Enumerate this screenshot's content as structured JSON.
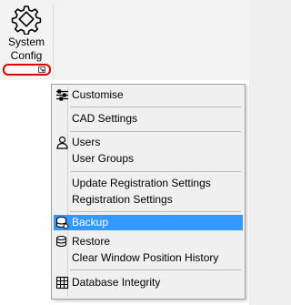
{
  "ribbon": {
    "system_config": {
      "line1": "System",
      "line2": "Config",
      "icon": "gear-icon"
    },
    "group_launcher_icon": "dialog-launcher-icon",
    "highlight_color": "#e00000"
  },
  "menu": {
    "items": [
      {
        "label": "Customise",
        "icon": "sliders-icon"
      },
      {
        "label": "CAD Settings"
      },
      {
        "label": "Users",
        "icon": "user-icon"
      },
      {
        "label": "User Groups"
      },
      {
        "label": "Update Registration Settings"
      },
      {
        "label": "Registration Settings"
      },
      {
        "label": "Backup",
        "icon": "database-icon",
        "highlighted": true
      },
      {
        "label": "Restore",
        "icon": "restore-icon"
      },
      {
        "label": "Clear Window Position History"
      },
      {
        "label": "Database Integrity",
        "icon": "grid-icon"
      }
    ],
    "highlight_color": "#3399ff"
  }
}
